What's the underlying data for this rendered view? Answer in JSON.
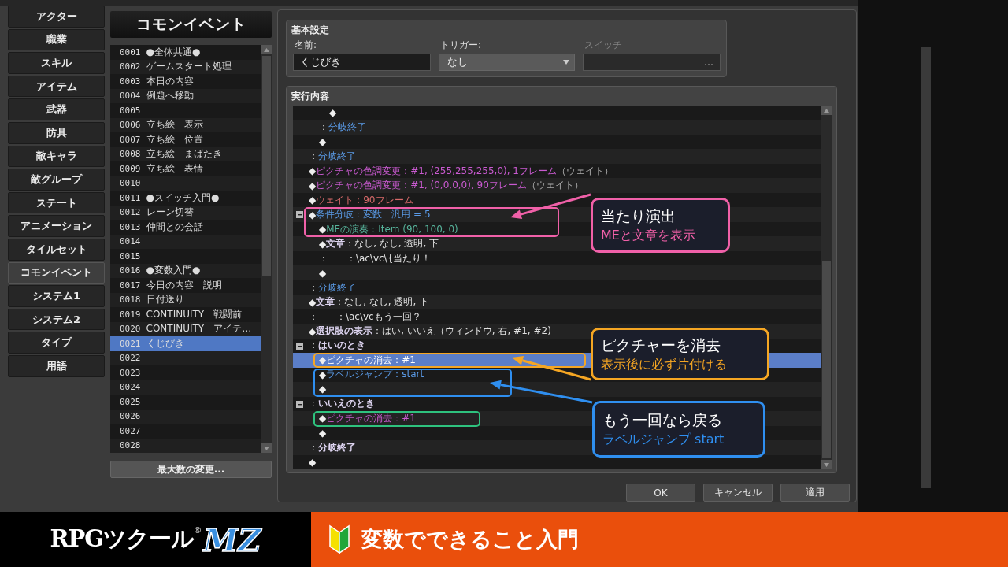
{
  "database_tabs": [
    {
      "label": "アクター",
      "selected": false
    },
    {
      "label": "職業",
      "selected": false
    },
    {
      "label": "スキル",
      "selected": false
    },
    {
      "label": "アイテム",
      "selected": false
    },
    {
      "label": "武器",
      "selected": false
    },
    {
      "label": "防具",
      "selected": false
    },
    {
      "label": "敵キャラ",
      "selected": false
    },
    {
      "label": "敵グループ",
      "selected": false
    },
    {
      "label": "ステート",
      "selected": false
    },
    {
      "label": "アニメーション",
      "selected": false
    },
    {
      "label": "タイルセット",
      "selected": false
    },
    {
      "label": "コモンイベント",
      "selected": true
    },
    {
      "label": "システム1",
      "selected": false
    },
    {
      "label": "システム2",
      "selected": false
    },
    {
      "label": "タイプ",
      "selected": false
    },
    {
      "label": "用語",
      "selected": false
    }
  ],
  "event_list": {
    "title": "コモンイベント",
    "items": [
      {
        "number": "0001",
        "name": "●全体共通●",
        "selected": false
      },
      {
        "number": "0002",
        "name": "ゲームスタート処理",
        "selected": false
      },
      {
        "number": "0003",
        "name": "本日の内容",
        "selected": false
      },
      {
        "number": "0004",
        "name": "例題へ移動",
        "selected": false
      },
      {
        "number": "0005",
        "selected": false
      },
      {
        "number": "0006",
        "name": "立ち絵　表示",
        "selected": false
      },
      {
        "number": "0007",
        "name": "立ち絵　位置",
        "selected": false
      },
      {
        "number": "0008",
        "name": "立ち絵　まばたき",
        "selected": false
      },
      {
        "number": "0009",
        "name": "立ち絵　表情",
        "selected": false
      },
      {
        "number": "0010",
        "selected": false
      },
      {
        "number": "0011",
        "name": "●スイッチ入門●",
        "selected": false
      },
      {
        "number": "0012",
        "name": "レーン切替",
        "selected": false
      },
      {
        "number": "0013",
        "name": "仲間との会話",
        "selected": false
      },
      {
        "number": "0014",
        "selected": false
      },
      {
        "number": "0015",
        "selected": false
      },
      {
        "number": "0016",
        "name": "●変数入門●",
        "selected": false
      },
      {
        "number": "0017",
        "name": "今日の内容　説明",
        "selected": false
      },
      {
        "number": "0018",
        "name": "日付送り",
        "selected": false
      },
      {
        "number": "0019",
        "name": "CONTINUITY　戦闘前",
        "selected": false
      },
      {
        "number": "0020",
        "name": "CONTINUITY　アイテ…",
        "selected": false
      },
      {
        "number": "0021",
        "name": "くじびき",
        "selected": true
      },
      {
        "number": "0022",
        "selected": false
      },
      {
        "number": "0023",
        "selected": false
      },
      {
        "number": "0024",
        "selected": false
      },
      {
        "number": "0025",
        "selected": false
      },
      {
        "number": "0026",
        "selected": false
      },
      {
        "number": "0027",
        "selected": false
      },
      {
        "number": "0028",
        "selected": false
      }
    ],
    "max_button": "最大数の変更..."
  },
  "basic_settings": {
    "title": "基本設定",
    "name_label": "名前:",
    "name_value": "くじびき",
    "trigger_label": "トリガー:",
    "trigger_value": "なし",
    "switch_label": "スイッチ",
    "switch_disabled": true,
    "switch_button": "…"
  },
  "contents": {
    "title": "実行内容",
    "lines": [
      {
        "children": [
          {
            "children": [
              {
                "prefix": "◆",
                "kind": "empty",
                "selected": false
              }
            ]
          },
          {
            "prefix": "：",
            "label": "分岐終了",
            "kind": "branch",
            "selected": false
          },
          {
            "prefix": "◆",
            "kind": "empty",
            "selected": false
          }
        ]
      },
      {
        "prefix": "：",
        "label": "分岐終了",
        "kind": "branch",
        "selected": false
      },
      {
        "prefix": "◆",
        "label": "ピクチャの色調変更",
        "params": "：#1, (255,255,255,0), 1フレーム",
        "suffix": "（ウェイト）",
        "kind": "picture",
        "selected": false
      },
      {
        "prefix": "◆",
        "label": "ピクチャの色調変更",
        "params": "：#1, (0,0,0,0), 90フレーム",
        "suffix": "（ウェイト）",
        "kind": "picture",
        "selected": false
      },
      {
        "prefix": "◆",
        "label": "ウェイト",
        "params": "：90フレーム",
        "kind": "wait",
        "selected": false
      },
      {
        "prefix": "◆",
        "label": "条件分岐",
        "params": "：変数　汎用 = 5",
        "kind": "branch",
        "expanded": true,
        "selected": false,
        "children": [
          {
            "prefix": "◆",
            "label": "MEの演奏",
            "params": "：Item (90, 100, 0)",
            "kind": "audio",
            "selected": false
          },
          {
            "prefix": "◆",
            "label": "文章",
            "params": "：なし, なし, 透明, 下",
            "kind": "message",
            "selected": false
          },
          {
            "prefix": "：",
            "params": "      ：\\ac\\vc\\{当たり！",
            "kind": "message",
            "selected": false
          },
          {
            "prefix": "◆",
            "kind": "empty",
            "selected": false
          }
        ]
      },
      {
        "prefix": "：",
        "label": "分岐終了",
        "kind": "branch",
        "selected": false
      },
      {
        "prefix": "◆",
        "label": "文章",
        "params": "：なし, なし, 透明, 下",
        "kind": "message",
        "selected": false
      },
      {
        "prefix": "：",
        "params": "      ：\\ac\\vcもう一回？",
        "kind": "message",
        "selected": false
      },
      {
        "prefix": "◆",
        "label": "選択肢の表示",
        "params": "：はい, いいえ（ウィンドウ, 右, #1, #2)",
        "kind": "message",
        "selected": false
      },
      {
        "prefix": "：",
        "label": "はいのとき",
        "kind": "message",
        "expanded": true,
        "selected": false,
        "children": [
          {
            "prefix": "◆",
            "label": "ピクチャの消去",
            "params": "：#1",
            "kind": "picture",
            "selected": true
          },
          {
            "prefix": "◆",
            "label": "ラベルジャンプ",
            "params": "：start",
            "kind": "branch",
            "selected": false
          },
          {
            "prefix": "◆",
            "kind": "empty",
            "selected": false
          }
        ]
      },
      {
        "prefix": "：",
        "label": "いいえのとき",
        "kind": "message",
        "expanded": true,
        "selected": false,
        "children": [
          {
            "prefix": "◆",
            "label": "ピクチャの消去",
            "params": "：#1",
            "kind": "picture",
            "selected": false
          },
          {
            "prefix": "◆",
            "kind": "empty",
            "selected": false
          }
        ]
      },
      {
        "prefix": "：",
        "label": "分岐終了",
        "kind": "message",
        "selected": false
      },
      {
        "prefix": "◆",
        "kind": "empty",
        "selected": false
      }
    ]
  },
  "highlights": [
    {
      "color": "#f060a8"
    },
    {
      "color": "#f5a623"
    },
    {
      "color": "#2f8ff0"
    },
    {
      "color": "#2ec27e"
    }
  ],
  "callouts": [
    {
      "title": "当たり演出",
      "subtitle": "MEと文章を表示",
      "color": "#f060a8"
    },
    {
      "title": "ピクチャーを消去",
      "subtitle": "表示後に必ず片付ける",
      "color": "#f5a623"
    },
    {
      "title": "もう一回なら戻る",
      "subtitle": "ラベルジャンプ start",
      "color": "#2f8ff0"
    }
  ],
  "dialog_buttons": [
    "OK",
    "キャンセル",
    "適用"
  ],
  "banner": {
    "logo": "RPGツクール",
    "logo_mark": "®",
    "logo_accent": "MZ",
    "title": "変数でできること入門"
  }
}
